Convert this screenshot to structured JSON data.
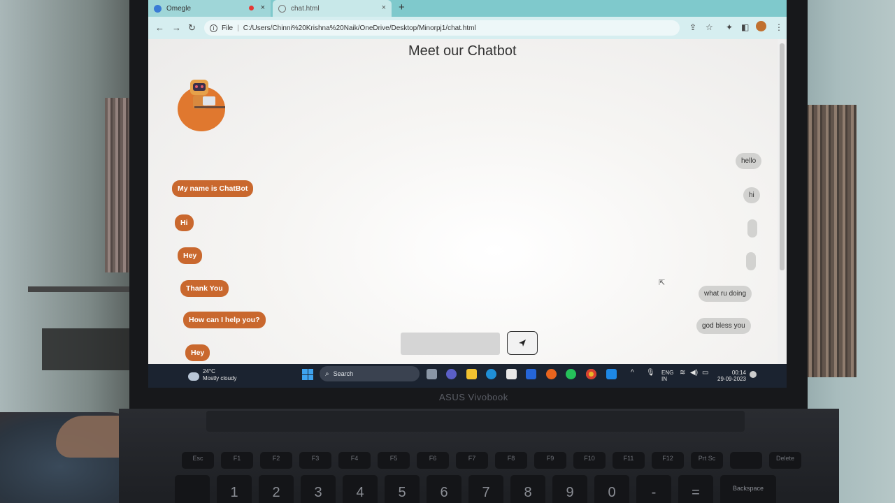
{
  "browser": {
    "tabs": [
      {
        "label": "Omegle"
      },
      {
        "label": "chat.html"
      }
    ],
    "new_tab": "+",
    "close": "×",
    "address": {
      "scheme_label": "File",
      "path": "C:/Users/Chinni%20Krishna%20Naik/OneDrive/Desktop/Minorpj1/chat.html"
    }
  },
  "page": {
    "title": "Meet our Chatbot",
    "bot_messages": [
      "My name is ChatBot",
      "Hi",
      "Hey",
      "Thank You",
      "How can I help you?",
      "Hey"
    ],
    "user_messages": [
      "hello",
      "hi",
      "",
      "",
      "what ru doing",
      "god bless you"
    ],
    "send_icon": "send-icon"
  },
  "taskbar": {
    "weather_temp": "24°C",
    "weather_text": "Mostly cloudy",
    "search_label": "Search",
    "lang_top": "ENG",
    "lang_bottom": "IN",
    "time": "00:14",
    "date": "29-09-2023"
  },
  "laptop": {
    "brand": "ASUS Vivobook",
    "fkeys": [
      "Esc",
      "F1",
      "F2",
      "F3",
      "F4",
      "F5",
      "F6",
      "F7",
      "F8",
      "F9",
      "F10",
      "F11",
      "F12",
      "Prt Sc",
      "",
      "Delete"
    ],
    "numkeys": [
      "",
      "1",
      "2",
      "3",
      "4",
      "5",
      "6",
      "7",
      "8",
      "9",
      "0",
      "-",
      "=",
      "Backspace"
    ]
  },
  "colors": {
    "bot_bubble": "#c9682e",
    "user_bubble": "#d2d2d0",
    "tab_bar": "#7fc9cc",
    "taskbar": "#1b2330"
  }
}
